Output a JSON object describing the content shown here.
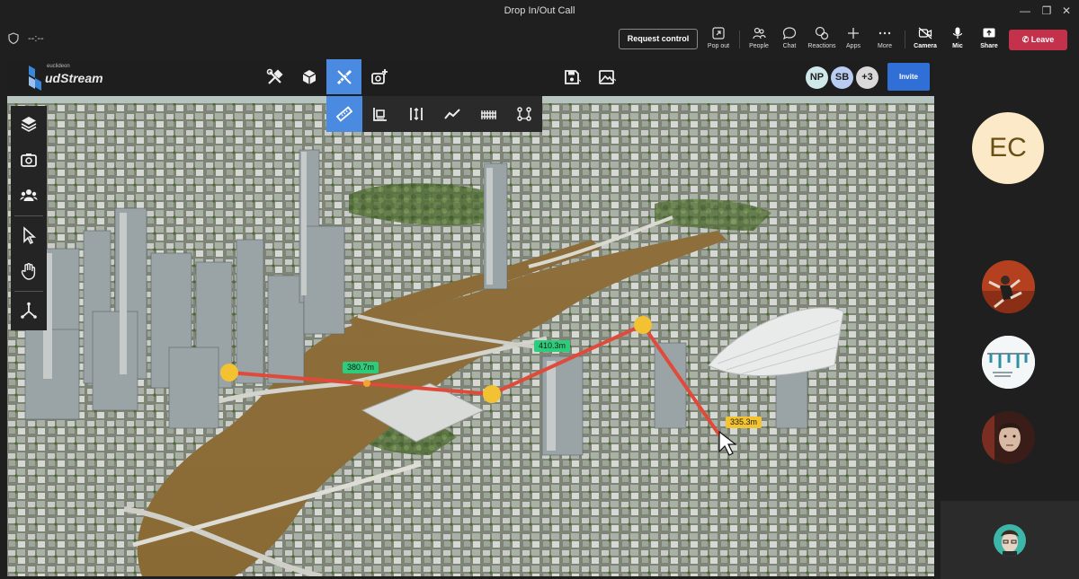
{
  "window": {
    "title": "Drop In/Out Call"
  },
  "call": {
    "timer": "--:--",
    "request_control": "Request control",
    "buttons": {
      "pop_out": "Pop out",
      "people": "People",
      "chat": "Chat",
      "reactions": "Reactions",
      "apps": "Apps",
      "more": "More",
      "camera": "Camera",
      "mic": "Mic",
      "share": "Share"
    },
    "leave": "Leave"
  },
  "app": {
    "brand_sub": "euclideon",
    "brand_name": "udStream",
    "invite": "Invite",
    "avatars": [
      {
        "initials": "NP",
        "color": "#cfe8ea"
      },
      {
        "initials": "SB",
        "color": "#b9cdf2"
      },
      {
        "initials": "+3",
        "color": "#d9d9d9"
      }
    ],
    "accent_color": "#4a8ae0"
  },
  "measurements": [
    {
      "label": "380.7m",
      "style": "green"
    },
    {
      "label": "410.3m",
      "style": "green"
    },
    {
      "label": "335.3m",
      "style": "yellow"
    }
  ],
  "participants": {
    "main_initials": "EC"
  }
}
